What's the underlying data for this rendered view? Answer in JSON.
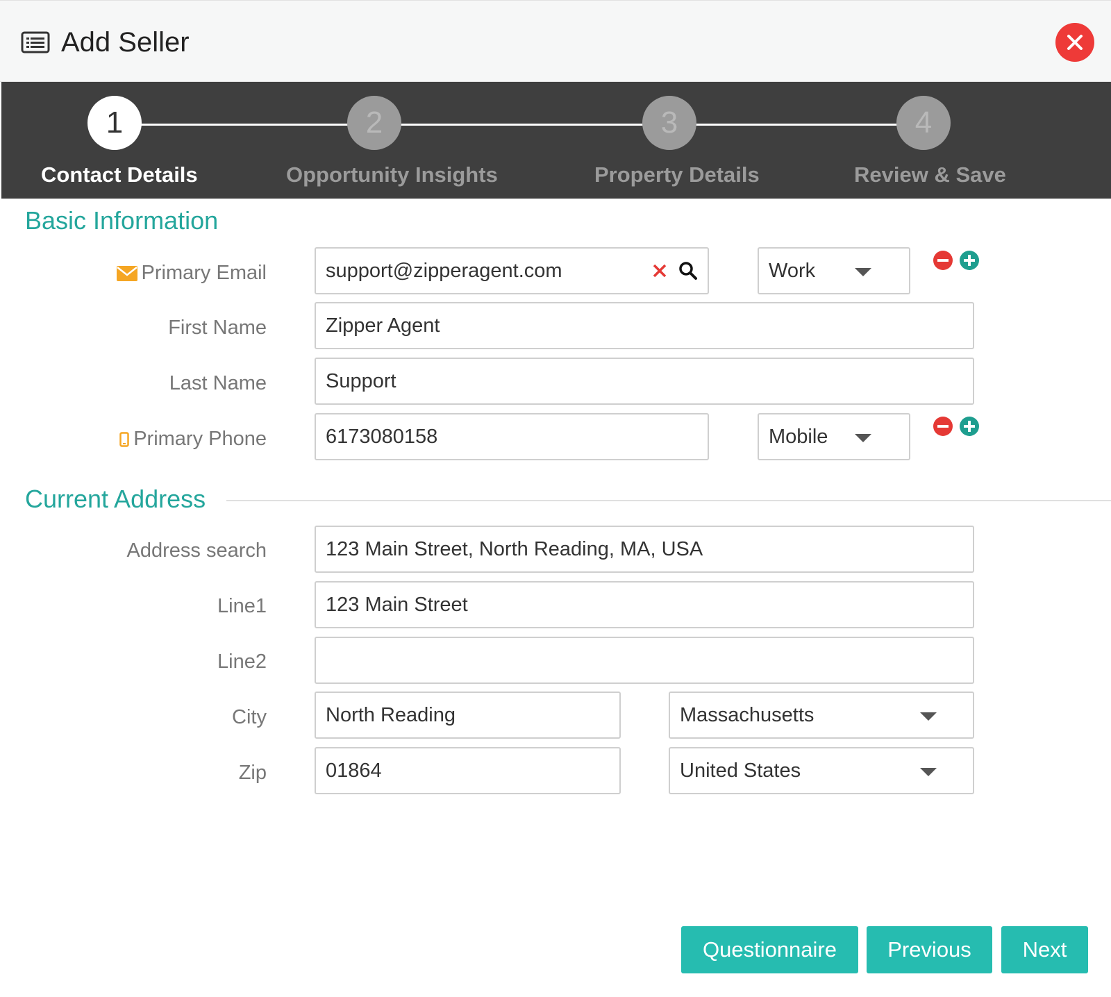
{
  "dialog": {
    "title": "Add Seller",
    "title_icon": "list-card-icon",
    "close_icon": "close-icon"
  },
  "stepper": {
    "steps": [
      {
        "number": "1",
        "label": "Contact Details",
        "state": "active"
      },
      {
        "number": "2",
        "label": "Opportunity Insights",
        "state": "inactive"
      },
      {
        "number": "3",
        "label": "Property Details",
        "state": "inactive"
      },
      {
        "number": "4",
        "label": "Review & Save",
        "state": "inactive"
      }
    ]
  },
  "basic_info": {
    "title": "Basic Information",
    "primary_email": {
      "label": "Primary Email",
      "value": "support@zipperagent.com",
      "type": "Work",
      "icon": "envelope-icon"
    },
    "first_name": {
      "label": "First Name",
      "value": "Zipper Agent"
    },
    "last_name": {
      "label": "Last Name",
      "value": "Support"
    },
    "primary_phone": {
      "label": "Primary Phone",
      "value": "6173080158",
      "type": "Mobile",
      "icon": "mobile-phone-icon"
    }
  },
  "address": {
    "title": "Current Address",
    "search": {
      "label": "Address search",
      "value": "123 Main Street, North Reading, MA, USA"
    },
    "line1": {
      "label": "Line1",
      "value": "123 Main Street"
    },
    "line2": {
      "label": "Line2",
      "value": ""
    },
    "city": {
      "label": "City",
      "value": "North Reading"
    },
    "state": {
      "value": "Massachusetts"
    },
    "zip": {
      "label": "Zip",
      "value": "01864"
    },
    "country": {
      "value": "United States"
    }
  },
  "footer": {
    "questionnaire": "Questionnaire",
    "previous": "Previous",
    "next": "Next"
  },
  "colors": {
    "accent": "#24a69c",
    "button": "#26bcb0",
    "stepper_bg": "#3f3f3f",
    "close": "#ee3a38",
    "email_icon": "#f5a623"
  }
}
